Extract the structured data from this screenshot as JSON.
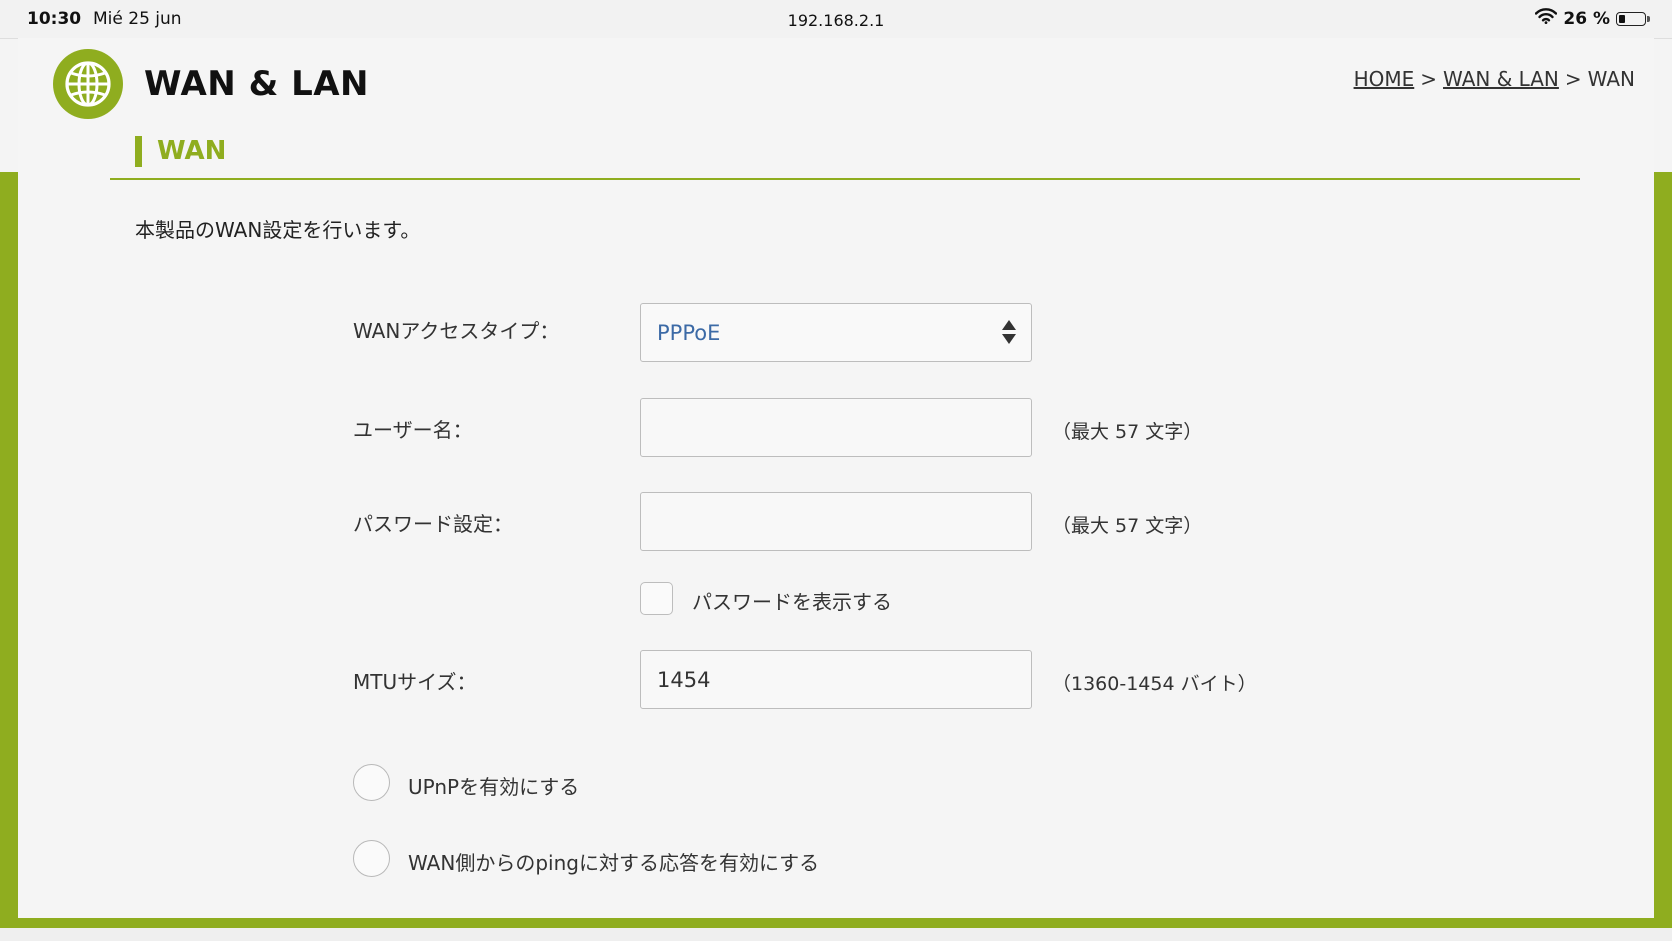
{
  "status_bar": {
    "time": "10:30",
    "date": "Mié 25 jun",
    "url": "192.168.2.1",
    "battery": "26 %",
    "battery_level": 0.26
  },
  "header": {
    "logo_icon": "globe-icon",
    "title": "WAN & LAN",
    "breadcrumb": {
      "home": "HOME",
      "sep1": ">",
      "section": "WAN & LAN",
      "sep2": ">",
      "current": "WAN"
    }
  },
  "section": {
    "title": "WAN",
    "description": "本製品のWAN設定を行います。"
  },
  "form": {
    "access_type": {
      "label": "WANアクセスタイプ：",
      "value": "PPPoE"
    },
    "username": {
      "label": "ユーザー名：",
      "value": "",
      "hint": "（最大 57 文字）"
    },
    "password": {
      "label": "パスワード設定：",
      "value": "",
      "hint": "（最大 57 文字）"
    },
    "show_password": {
      "label": "パスワードを表示する",
      "checked": false
    },
    "mtu": {
      "label": "MTUサイズ：",
      "value": "1454",
      "hint": "（1360-1454 バイト）"
    },
    "upnp": {
      "label": "UPnPを有効にする",
      "selected": false
    },
    "ping": {
      "label": "WAN側からのpingに対する応答を有効にする",
      "selected": false
    }
  },
  "colors": {
    "accent": "#8fad1f",
    "select_text": "#3c6aa6"
  }
}
